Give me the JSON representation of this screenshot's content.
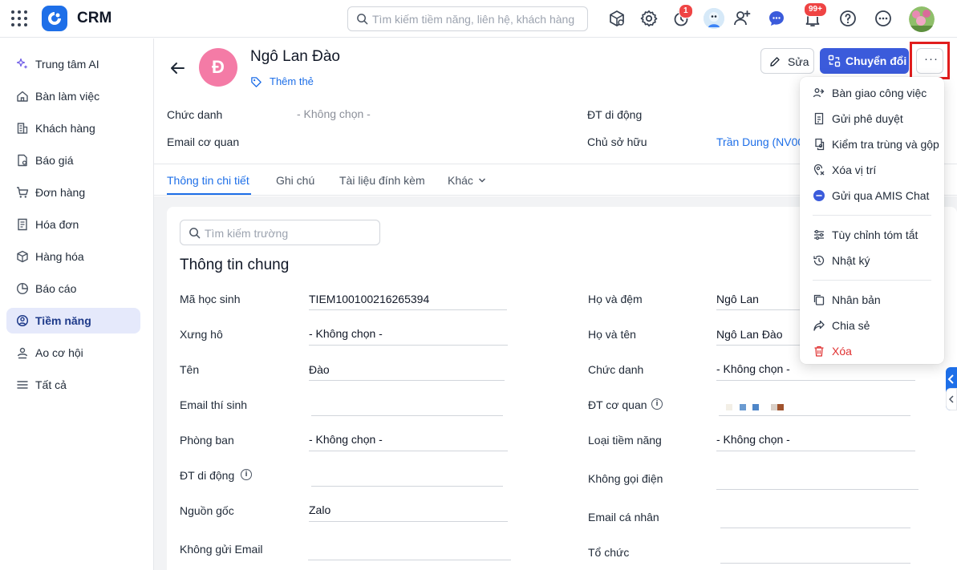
{
  "app": {
    "name": "CRM",
    "search_placeholder": "Tìm kiếm tiềm năng, liên hệ, khách hàng",
    "badges": {
      "timer": "1",
      "notifications": "99+"
    },
    "brand_color": "#1e6fe8"
  },
  "sidebar": {
    "items": [
      {
        "label": "Trung tâm AI",
        "icon": "sparkle-icon"
      },
      {
        "label": "Bàn làm việc",
        "icon": "home-icon"
      },
      {
        "label": "Khách hàng",
        "icon": "building-icon"
      },
      {
        "label": "Báo giá",
        "icon": "quote-icon"
      },
      {
        "label": "Đơn hàng",
        "icon": "cart-icon"
      },
      {
        "label": "Hóa đơn",
        "icon": "invoice-icon"
      },
      {
        "label": "Hàng hóa",
        "icon": "box-icon"
      },
      {
        "label": "Báo cáo",
        "icon": "pie-chart-icon"
      },
      {
        "label": "Tiềm năng",
        "icon": "target-icon",
        "active": true
      },
      {
        "label": "Ao cơ hội",
        "icon": "opportunity-icon"
      },
      {
        "label": "Tất cả",
        "icon": "menu-icon"
      }
    ]
  },
  "record": {
    "avatar_letter": "Đ",
    "avatar_color": "#f47ba6",
    "name": "Ngô Lan Đào",
    "add_tag": "Thêm thẻ",
    "edit_label": "Sửa",
    "convert_label": "Chuyển đổi",
    "more_label": "···"
  },
  "summary": {
    "job_title_label": "Chức danh",
    "job_title_value": "- Không chọn -",
    "work_email_label": "Email cơ quan",
    "mobile_label": "ĐT di động",
    "owner_label": "Chủ sở hữu",
    "owner_value": "Trần Dung (NV00"
  },
  "tabs": [
    "Thông tin chi tiết",
    "Ghi chú",
    "Tài liệu đính kèm",
    "Khác"
  ],
  "detail": {
    "search_placeholder": "Tìm kiếm trường",
    "section_title": "Thông tin chung",
    "left_fields": [
      {
        "label": "Mã học sinh",
        "value": "TIEM10010021626539​4"
      },
      {
        "label": "Xưng hô",
        "value": "- Không chọn -"
      },
      {
        "label": "Tên",
        "value": "Đào"
      },
      {
        "label": "Email thí sinh",
        "value": ""
      },
      {
        "label": "Phòng ban",
        "value": "- Không chọn -"
      },
      {
        "label": "ĐT di động",
        "value": ""
      },
      {
        "label": "Nguồn gốc",
        "value": "Zalo"
      },
      {
        "label": "Không gửi Email",
        "value": ""
      }
    ],
    "right_fields": [
      {
        "label": "Họ và đệm",
        "value": "Ngô Lan"
      },
      {
        "label": "Họ và tên",
        "value": "Ngô Lan Đào"
      },
      {
        "label": "Chức danh",
        "value": "- Không chọn -"
      },
      {
        "label": "ĐT cơ quan",
        "value": ""
      },
      {
        "label": "Loại tiềm năng",
        "value": "- Không chọn -"
      },
      {
        "label": "Không gọi điện",
        "value": ""
      },
      {
        "label": "Email cá nhân",
        "value": ""
      },
      {
        "label": "Tổ chức",
        "value": ""
      }
    ]
  },
  "menu": {
    "items": [
      {
        "label": "Bàn giao công việc",
        "icon": "handover-icon"
      },
      {
        "label": "Gửi phê duyệt",
        "icon": "approval-icon"
      },
      {
        "label": "Kiểm tra trùng và gộp",
        "icon": "duplicate-check-icon"
      },
      {
        "label": "Xóa vị trí",
        "icon": "location-remove-icon"
      },
      {
        "label": "Gửi qua AMIS Chat",
        "icon": "chat-icon"
      },
      {
        "label": "Tùy chỉnh tóm tắt",
        "icon": "sliders-icon"
      },
      {
        "label": "Nhật ký",
        "icon": "history-icon"
      },
      {
        "label": "Nhân bản",
        "icon": "copy-icon"
      },
      {
        "label": "Chia sẻ",
        "icon": "share-icon"
      },
      {
        "label": "Xóa",
        "icon": "trash-icon",
        "danger": true
      }
    ]
  }
}
